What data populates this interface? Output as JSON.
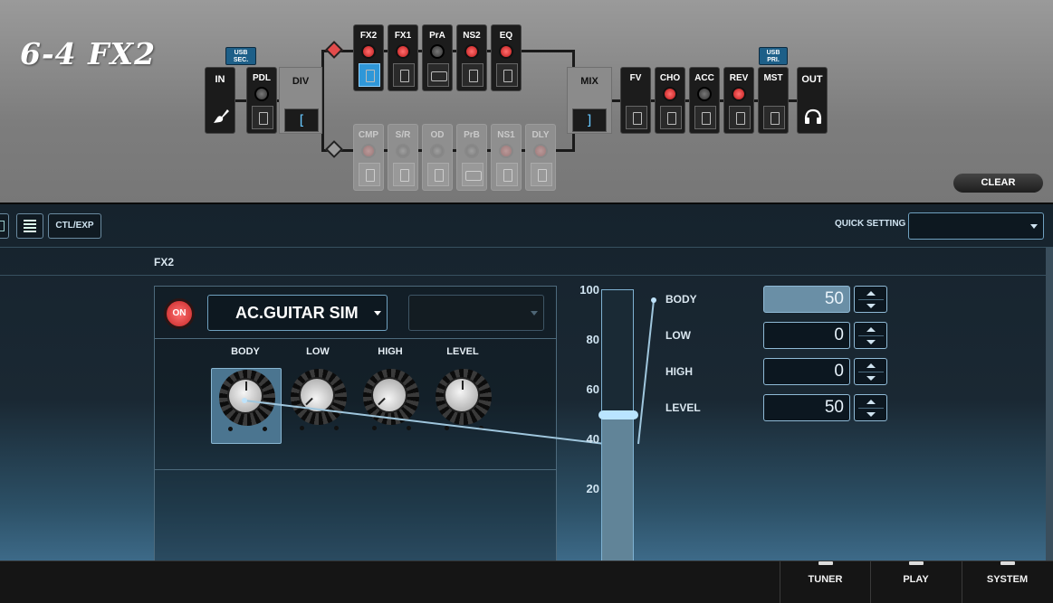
{
  "patch": {
    "title": "6-4 FX2"
  },
  "chain": {
    "input_label": "IN",
    "output_label": "OUT",
    "usb_sec_label": "USB SEC.",
    "usb_pri_label": "USB PRI.",
    "pdl_label": "PDL",
    "div_label": "DIV",
    "div_symbol": "[",
    "mix_label": "MIX",
    "mix_symbol": "]",
    "route_a": [
      {
        "label": "FX2",
        "knob": "red",
        "pic": "pedal",
        "selected": true
      },
      {
        "label": "FX1",
        "knob": "red",
        "pic": "pedal",
        "selected": false
      },
      {
        "label": "PrA",
        "knob": "gray",
        "pic": "amp",
        "selected": false
      },
      {
        "label": "NS2",
        "knob": "red",
        "pic": "pedal",
        "selected": false
      },
      {
        "label": "EQ",
        "knob": "red",
        "pic": "pedal",
        "selected": false
      }
    ],
    "route_b": [
      {
        "label": "CMP",
        "knob": "red"
      },
      {
        "label": "S/R",
        "knob": "gray"
      },
      {
        "label": "OD",
        "knob": "gray"
      },
      {
        "label": "PrB",
        "knob": "gray"
      },
      {
        "label": "NS1",
        "knob": "red"
      },
      {
        "label": "DLY",
        "knob": "red"
      }
    ],
    "post_blocks": [
      {
        "label": "FV",
        "knob": "none"
      },
      {
        "label": "CHO",
        "knob": "red"
      },
      {
        "label": "ACC",
        "knob": "gray"
      },
      {
        "label": "REV",
        "knob": "red"
      },
      {
        "label": "MST",
        "knob": "none"
      }
    ],
    "clear_label": "CLEAR"
  },
  "toolbar": {
    "ctl_exp_label": "CTL/EXP",
    "quick_setting_label": "QUICK SETTING",
    "quick_setting_value": ""
  },
  "section": {
    "title": "FX2"
  },
  "effect": {
    "on_label": "ON",
    "type": "AC.GUITAR SIM",
    "variation": "",
    "knobs": [
      {
        "label": "BODY",
        "value": 50,
        "selected": true
      },
      {
        "label": "LOW",
        "value": 0,
        "selected": false
      },
      {
        "label": "HIGH",
        "value": 0,
        "selected": false
      },
      {
        "label": "LEVEL",
        "value": 50,
        "selected": false
      }
    ]
  },
  "slider": {
    "ticks": [
      "100",
      "80",
      "60",
      "40",
      "20"
    ],
    "value": 50,
    "max": 100
  },
  "params": [
    {
      "name": "BODY",
      "value": "50",
      "selected": true
    },
    {
      "name": "LOW",
      "value": "0",
      "selected": false
    },
    {
      "name": "HIGH",
      "value": "0",
      "selected": false
    },
    {
      "name": "LEVEL",
      "value": "50",
      "selected": false
    }
  ],
  "bottom": {
    "tuner_label": "TUNER",
    "play_label": "PLAY",
    "system_label": "SYSTEM"
  },
  "colors": {
    "accent": "#2f97d8",
    "on_red": "#c62626",
    "slider_fill": "#9dcde9"
  }
}
